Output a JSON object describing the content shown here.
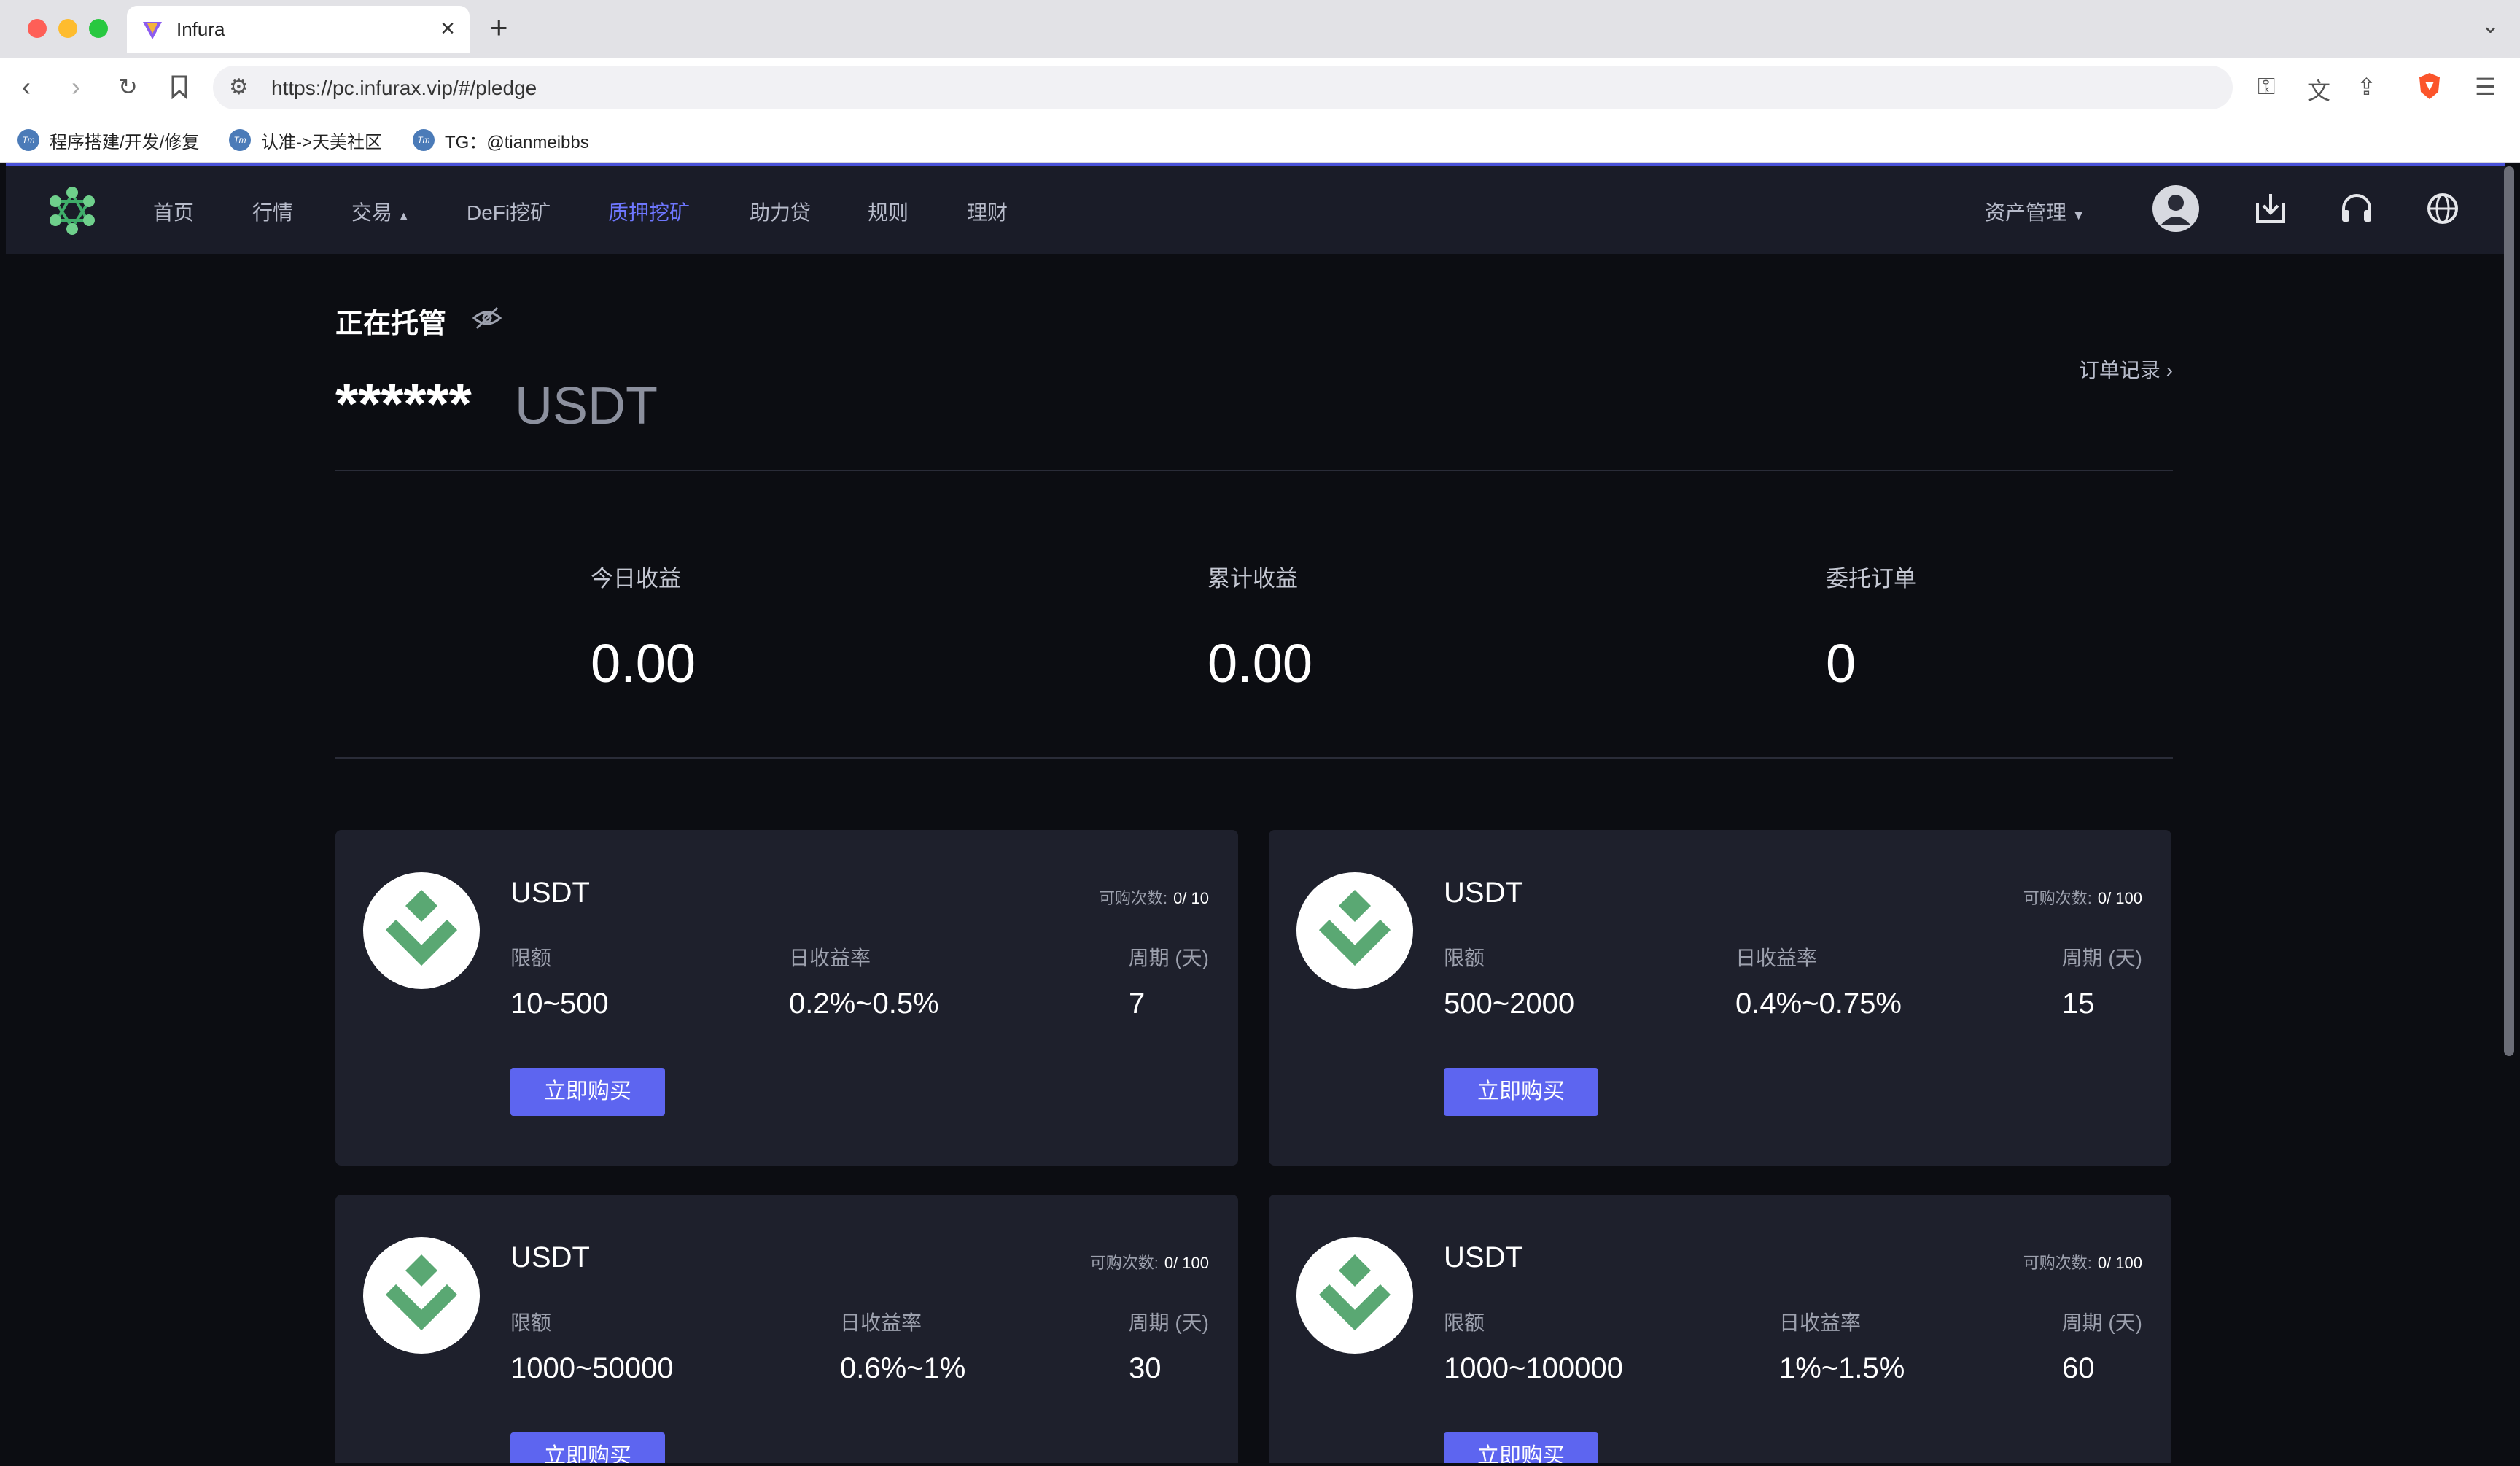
{
  "browser": {
    "tab_title": "Infura",
    "url": "https://pc.infurax.vip/#/pledge",
    "bookmarks": [
      "程序搭建/开发/修复",
      "认准->天美社区",
      "TG：@tianmeibbs"
    ]
  },
  "header": {
    "nav": [
      "首页",
      "行情",
      "交易",
      "DeFi挖矿",
      "质押挖矿",
      "助力贷",
      "规则",
      "理财"
    ],
    "active_nav": "质押挖矿",
    "asset_mgmt": "资产管理"
  },
  "hosting": {
    "title": "正在托管",
    "amount": "******",
    "unit": "USDT",
    "order_record": "订单记录"
  },
  "stats": [
    {
      "label": "今日收益",
      "value": "0.00"
    },
    {
      "label": "累计收益",
      "value": "0.00"
    },
    {
      "label": "委托订单",
      "value": "0"
    }
  ],
  "cards": [
    {
      "name": "USDT",
      "count_label": "可购次数:",
      "count": "0/ 10",
      "limit_label": "限额",
      "limit": "10~500",
      "rate_label": "日收益率",
      "rate": "0.2%~0.5%",
      "period_label": "周期 (天)",
      "period": "7",
      "button": "立即购买"
    },
    {
      "name": "USDT",
      "count_label": "可购次数:",
      "count": "0/ 100",
      "limit_label": "限额",
      "limit": "500~2000",
      "rate_label": "日收益率",
      "rate": "0.4%~0.75%",
      "period_label": "周期 (天)",
      "period": "15",
      "button": "立即购买"
    },
    {
      "name": "USDT",
      "count_label": "可购次数:",
      "count": "0/ 100",
      "limit_label": "限额",
      "limit": "1000~50000",
      "rate_label": "日收益率",
      "rate": "0.6%~1%",
      "period_label": "周期 (天)",
      "period": "30",
      "button": "立即购买"
    },
    {
      "name": "USDT",
      "count_label": "可购次数:",
      "count": "0/ 100",
      "limit_label": "限额",
      "limit": "1000~100000",
      "rate_label": "日收益率",
      "rate": "1%~1.5%",
      "period_label": "周期 (天)",
      "period": "60",
      "button": "立即购买"
    }
  ],
  "colors": {
    "accent": "#5d65f0",
    "active_nav": "#6e77ff",
    "coin_green": "#5aa873"
  }
}
